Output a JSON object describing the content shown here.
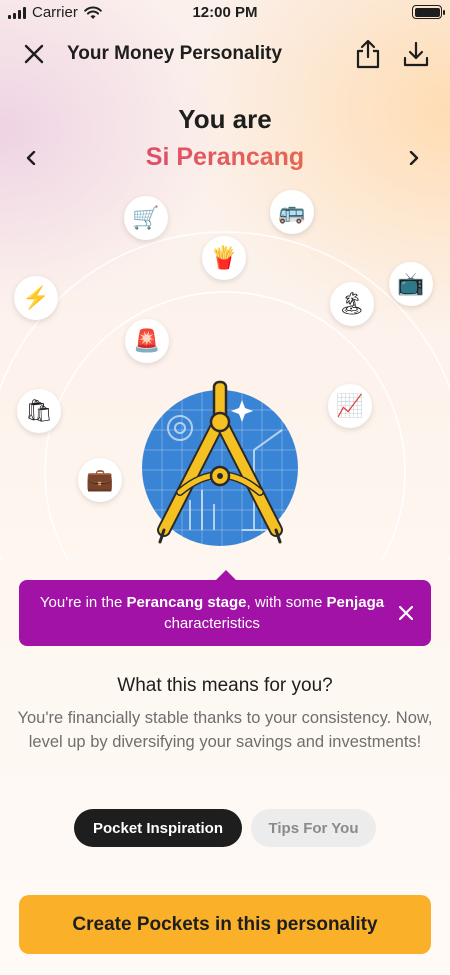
{
  "status_bar": {
    "carrier": "Carrier",
    "time": "12:00 PM"
  },
  "header": {
    "title": "Your Money Personality",
    "icons": [
      "close-icon",
      "share-icon",
      "download-icon"
    ]
  },
  "hero": {
    "prefix": "You are",
    "personality": "Si Perancang",
    "main_illustration": "compass-icon",
    "orbit_icons": [
      {
        "name": "shopping-cart-icon",
        "glyph": "🛒"
      },
      {
        "name": "bus-icon",
        "glyph": "🚌"
      },
      {
        "name": "fries-icon",
        "glyph": "🍟"
      },
      {
        "name": "lightning-icon",
        "glyph": "⚡"
      },
      {
        "name": "tv-icon",
        "glyph": "📺"
      },
      {
        "name": "island-icon",
        "glyph": "🏝"
      },
      {
        "name": "siren-icon",
        "glyph": "🚨"
      },
      {
        "name": "shopping-bags-icon",
        "glyph": "🛍"
      },
      {
        "name": "chart-increasing-icon",
        "glyph": "📈"
      },
      {
        "name": "briefcase-icon",
        "glyph": "💼"
      }
    ]
  },
  "stage_banner": {
    "text_1": "You're in the ",
    "stage": "Perancang stage",
    "text_2": ", with some ",
    "secondary": "Penjaga",
    "text_3": " characteristics"
  },
  "meaning": {
    "title": "What this means for you?",
    "description": "You're financially stable thanks to your consistency. Now, level up by diversifying your savings and investments!"
  },
  "tabs": [
    {
      "label": "Pocket Inspiration",
      "active": true
    },
    {
      "label": "Tips For You",
      "active": false
    }
  ],
  "cta": {
    "label": "Create Pockets in this personality"
  },
  "colors": {
    "banner": "#a212a6",
    "cta": "#fbb02a",
    "gradient_start": "#d1337e",
    "gradient_end": "#ec7b3c",
    "hero_circle": "#3a84d6",
    "compass": "#f5c022"
  }
}
